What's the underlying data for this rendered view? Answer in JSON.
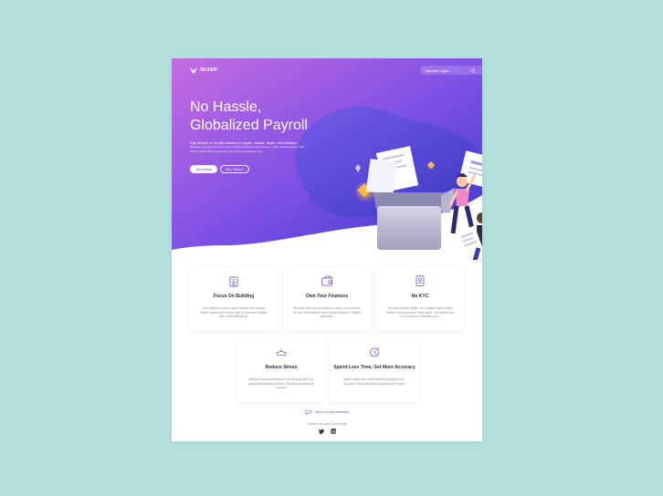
{
  "brand": {
    "name": "WIXEP",
    "accent": "#6a4fe0",
    "gradient_start": "#c56ce0",
    "gradient_end": "#3a3ac8"
  },
  "header": {
    "login_label": "Member Login",
    "login_icon": "sign-in-icon"
  },
  "hero": {
    "title_line1": "No Hassle,",
    "title_line2": "Globalized Payroll",
    "lead": "Pay remote or on-site workers in crypto - easier, faster, and cheaper.",
    "body": "Manage your payroll, keep track of payments and automate your crypto disbursements with Wixep, while Wixep automates the record keeping for you.",
    "primary_cta": "Join Wixep",
    "secondary_cta": "Why Wixep?"
  },
  "features": [
    {
      "icon": "building-icon",
      "title": "Focus On Building",
      "text": "Your workers choose how to access their money. Wixep makes sure they're paid on time and updates them with notifications."
    },
    {
      "icon": "wallet-icon",
      "title": "Own Your Finances",
      "text": "We make sure you're always in control of your funds. So you never have to worry about blocked or unfilled payments."
    },
    {
      "icon": "id-badge-icon",
      "title": "No KYC",
      "text": "We built a easier, faster, and cheaper app to make workers' and employers' lives easier. You decide how to onboard and offboard yours."
    },
    {
      "icon": "relax-icon",
      "title": "Reduce Stress",
      "text": "Wixep's easy-to-understand records plug right in to popular accounting software. No more dreading for season!"
    },
    {
      "icon": "clock-icon",
      "title": "Spend Less Time, Get More Accuracy",
      "text": "Wixep takes care of the record keeping for you. Export a CSV at any time to update your books."
    }
  ],
  "footer": {
    "feedback_label": "Send us your feedback",
    "community_label": "Connect to Open Community",
    "socials": [
      "twitter-icon",
      "linkedin-icon"
    ]
  }
}
